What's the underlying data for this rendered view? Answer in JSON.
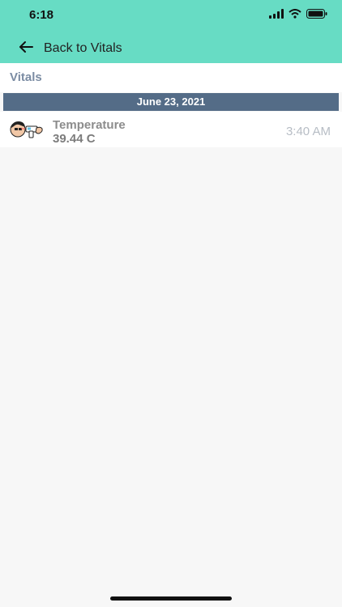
{
  "status_bar": {
    "time": "6:18",
    "icons": [
      "signal-icon",
      "wifi-icon",
      "battery-icon"
    ]
  },
  "nav": {
    "back_label": "Back to Vitals",
    "back_icon": "arrow-left-icon"
  },
  "section": {
    "title": "Vitals"
  },
  "date_group": {
    "date": "June 23, 2021"
  },
  "vitals": [
    {
      "name": "Temperature",
      "value": "39.44 C",
      "time": "3:40 AM",
      "icon": "thermometer-person-icon"
    }
  ],
  "colors": {
    "header_bg": "#67dcc4",
    "date_bar_bg": "#546c87",
    "section_title": "#7b8ca3"
  }
}
